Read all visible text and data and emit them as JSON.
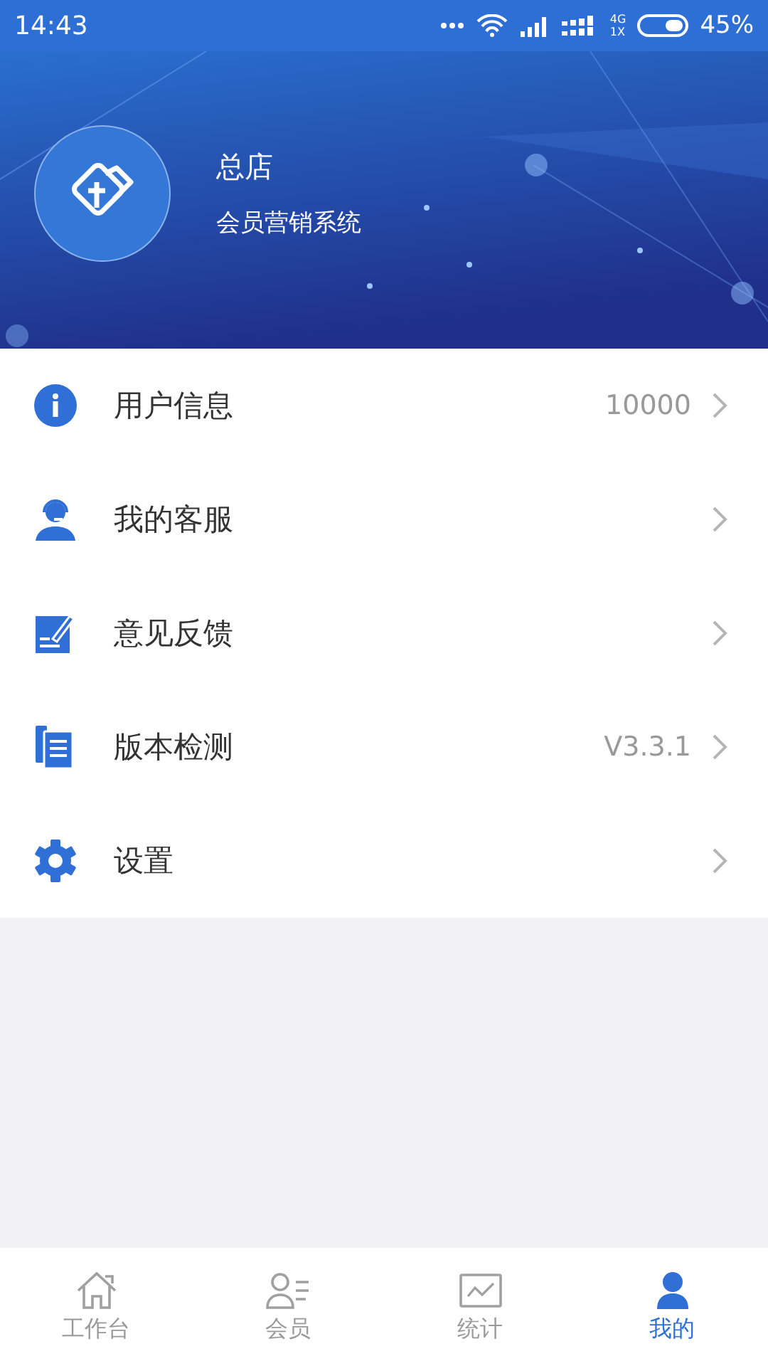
{
  "status_bar": {
    "time": "14:43",
    "network_top": "4G",
    "network_bottom": "1X",
    "battery": "45%"
  },
  "header": {
    "title": "总店",
    "subtitle": "会员营销系统"
  },
  "menu": [
    {
      "kind": "info",
      "label": "用户信息",
      "value": "10000"
    },
    {
      "kind": "service",
      "label": "我的客服"
    },
    {
      "kind": "feedback",
      "label": "意见反馈"
    },
    {
      "kind": "version",
      "label": "版本检测",
      "value": "V3.3.1"
    },
    {
      "kind": "settings",
      "label": "设置"
    }
  ],
  "tab_bar": [
    {
      "kind": "home",
      "label": "工作台",
      "selected": false
    },
    {
      "kind": "members",
      "label": "会员",
      "selected": false
    },
    {
      "kind": "stats",
      "label": "统计",
      "selected": false
    },
    {
      "kind": "me",
      "label": "我的",
      "selected": true
    }
  ]
}
